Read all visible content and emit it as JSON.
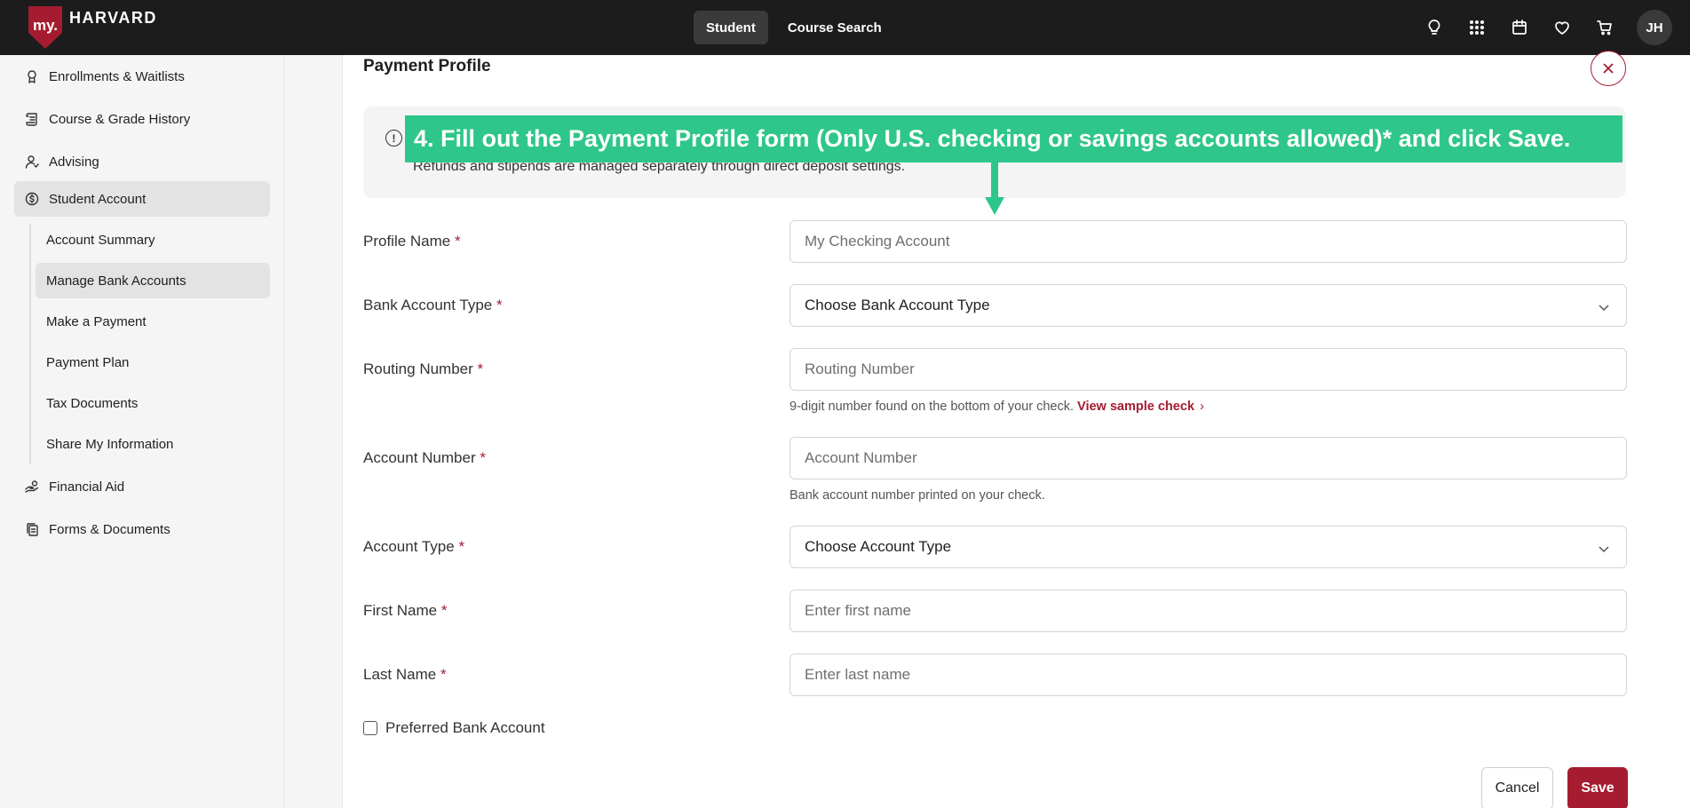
{
  "topbar": {
    "logo_my": "my.",
    "logo_text": "HARVARD",
    "nav": [
      "Student",
      "Course Search"
    ],
    "avatar_initials": "JH",
    "icons": [
      "lightbulb-icon",
      "apps-grid-icon",
      "calendar-icon",
      "heart-icon",
      "cart-icon"
    ]
  },
  "sidebar": {
    "items": [
      {
        "label": "Enrollments & Waitlists",
        "icon": "award-icon"
      },
      {
        "label": "Course & Grade History",
        "icon": "scroll-icon"
      },
      {
        "label": "Advising",
        "icon": "person-icon"
      },
      {
        "label": "Student Account",
        "icon": "dollar-circle-icon"
      },
      {
        "label": "Financial Aid",
        "icon": "hand-coin-icon"
      },
      {
        "label": "Forms & Documents",
        "icon": "documents-icon"
      }
    ],
    "sub_items": [
      "Account Summary",
      "Manage Bank Accounts",
      "Make a Payment",
      "Payment Plan",
      "Tax Documents",
      "Share My Information"
    ]
  },
  "main": {
    "title": "Payment Profile",
    "info_text": "Refunds and stipends are managed separately through direct deposit settings.",
    "banner": "4. Fill out the Payment Profile form (Only U.S. checking or savings accounts allowed)* and click Save.",
    "required_mark": "*",
    "fields": {
      "profile_name": {
        "label": "Profile Name",
        "placeholder": "My Checking Account"
      },
      "bank_account_type": {
        "label": "Bank Account Type",
        "value": "Choose Bank Account Type"
      },
      "routing_number": {
        "label": "Routing Number",
        "placeholder": "Routing Number",
        "help": "9-digit number found on the bottom of your check.",
        "help_link": "View sample check",
        "help_link_chevron": "›"
      },
      "account_number": {
        "label": "Account Number",
        "placeholder": "Account Number",
        "help": "Bank account number printed on your check."
      },
      "account_type": {
        "label": "Account Type",
        "value": "Choose Account Type"
      },
      "first_name": {
        "label": "First Name",
        "placeholder": "Enter first name"
      },
      "last_name": {
        "label": "Last Name",
        "placeholder": "Enter last name"
      }
    },
    "preferred_label": "Preferred Bank Account",
    "cancel_label": "Cancel",
    "save_label": "Save"
  },
  "colors": {
    "brand": "#a51c30",
    "banner": "#2ec68a",
    "topbar": "#1c1c1c"
  }
}
